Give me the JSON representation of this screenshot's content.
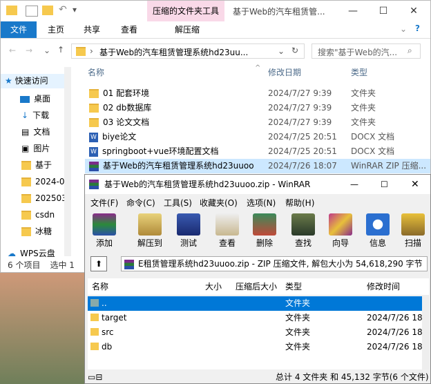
{
  "explorer": {
    "context_tab": "压缩的文件夹工具",
    "title": "基于Web的汽车租赁管...",
    "ribbon_tabs": [
      "文件",
      "主页",
      "共享",
      "查看",
      "解压缩"
    ],
    "address": "基于Web的汽车租赁管理系统hd23uu...",
    "search_placeholder": "搜索\"基于Web的汽...",
    "columns": {
      "name": "名称",
      "date": "修改日期",
      "type": "类型"
    },
    "sidebar": [
      "快速访问",
      "桌面",
      "下载",
      "文档",
      "图片",
      "基于",
      "2024-0",
      "202503",
      "csdn",
      "冰糖",
      "WPS云盘"
    ],
    "files": [
      {
        "name": "01 配套环境",
        "date": "2024/7/27 9:39",
        "type": "文件夹",
        "icon": "folder"
      },
      {
        "name": "02 db数据库",
        "date": "2024/7/27 9:39",
        "type": "文件夹",
        "icon": "folder"
      },
      {
        "name": "03 论文文档",
        "date": "2024/7/27 9:39",
        "type": "文件夹",
        "icon": "folder"
      },
      {
        "name": "biye论文",
        "date": "2024/7/25 20:51",
        "type": "DOCX 文档",
        "icon": "word"
      },
      {
        "name": "springboot+vue环境配置文档",
        "date": "2024/7/25 20:51",
        "type": "DOCX 文档",
        "icon": "word"
      },
      {
        "name": "基于Web的汽车租赁管理系统hd23uuoo",
        "date": "2024/7/26 18:07",
        "type": "WinRAR ZIP 压缩...",
        "icon": "rar"
      }
    ],
    "status_count": "6 个项目",
    "status_selected": "选中 1"
  },
  "winrar": {
    "title": "基于Web的汽车租赁管理系统hd23uuoo.zip - WinRAR",
    "menu": [
      "文件(F)",
      "命令(C)",
      "工具(S)",
      "收藏夹(O)",
      "选项(N)",
      "帮助(H)"
    ],
    "tools": [
      "添加",
      "解压到",
      "测试",
      "查看",
      "删除",
      "查找",
      "向导",
      "信息",
      "扫描"
    ],
    "path": "E租赁管理系统hd23uuoo.zip - ZIP 压缩文件, 解包大小为 54,618,290 字节",
    "columns": {
      "name": "名称",
      "size": "大小",
      "packed": "压缩后大小",
      "type": "类型",
      "date": "修改时间"
    },
    "rows": [
      {
        "name": "..",
        "type": "文件夹",
        "date": ""
      },
      {
        "name": "target",
        "type": "文件夹",
        "date": "2024/7/26 18"
      },
      {
        "name": "src",
        "type": "文件夹",
        "date": "2024/7/26 18"
      },
      {
        "name": "db",
        "type": "文件夹",
        "date": "2024/7/26 18"
      }
    ],
    "status": "总计 4 文件夹 和 45,132 字节(6 个文件)"
  }
}
